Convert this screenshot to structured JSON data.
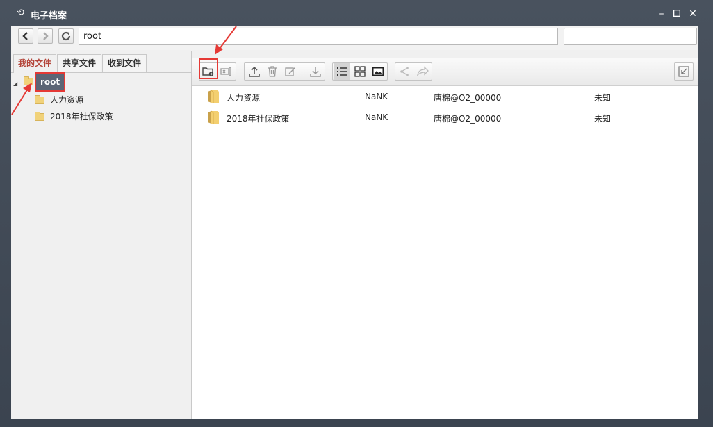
{
  "window": {
    "title": "电子档案",
    "icon": "refresh-icon",
    "controls": [
      "minimize-icon",
      "maximize-icon",
      "close-icon"
    ]
  },
  "addressbar": {
    "path": "root",
    "search_value": ""
  },
  "left_panel": {
    "tabs": [
      {
        "label": "我的文件",
        "active": true
      },
      {
        "label": "共享文件",
        "active": false
      },
      {
        "label": "收到文件",
        "active": false
      }
    ],
    "tree": {
      "root": "root",
      "children": [
        "人力资源",
        "2018年社保政策"
      ]
    }
  },
  "toolbar": {
    "buttons": [
      "new-folder-icon",
      "rename-icon",
      "upload-icon",
      "delete-icon",
      "edit-icon",
      "download-icon",
      "list-view-icon",
      "grid-view-icon",
      "image-view-icon",
      "share-icon",
      "forward-icon",
      "collapse-icon"
    ]
  },
  "files": [
    {
      "name": "人力资源",
      "size": "NaNK",
      "owner": "唐棉@O2_00000",
      "status": "未知"
    },
    {
      "name": "2018年社保政策",
      "size": "NaNK",
      "owner": "唐棉@O2_00000",
      "status": "未知"
    }
  ],
  "colors": {
    "active_tab": "#b4453a",
    "selected_node": "#5c6575",
    "annotation": "#e53935"
  }
}
